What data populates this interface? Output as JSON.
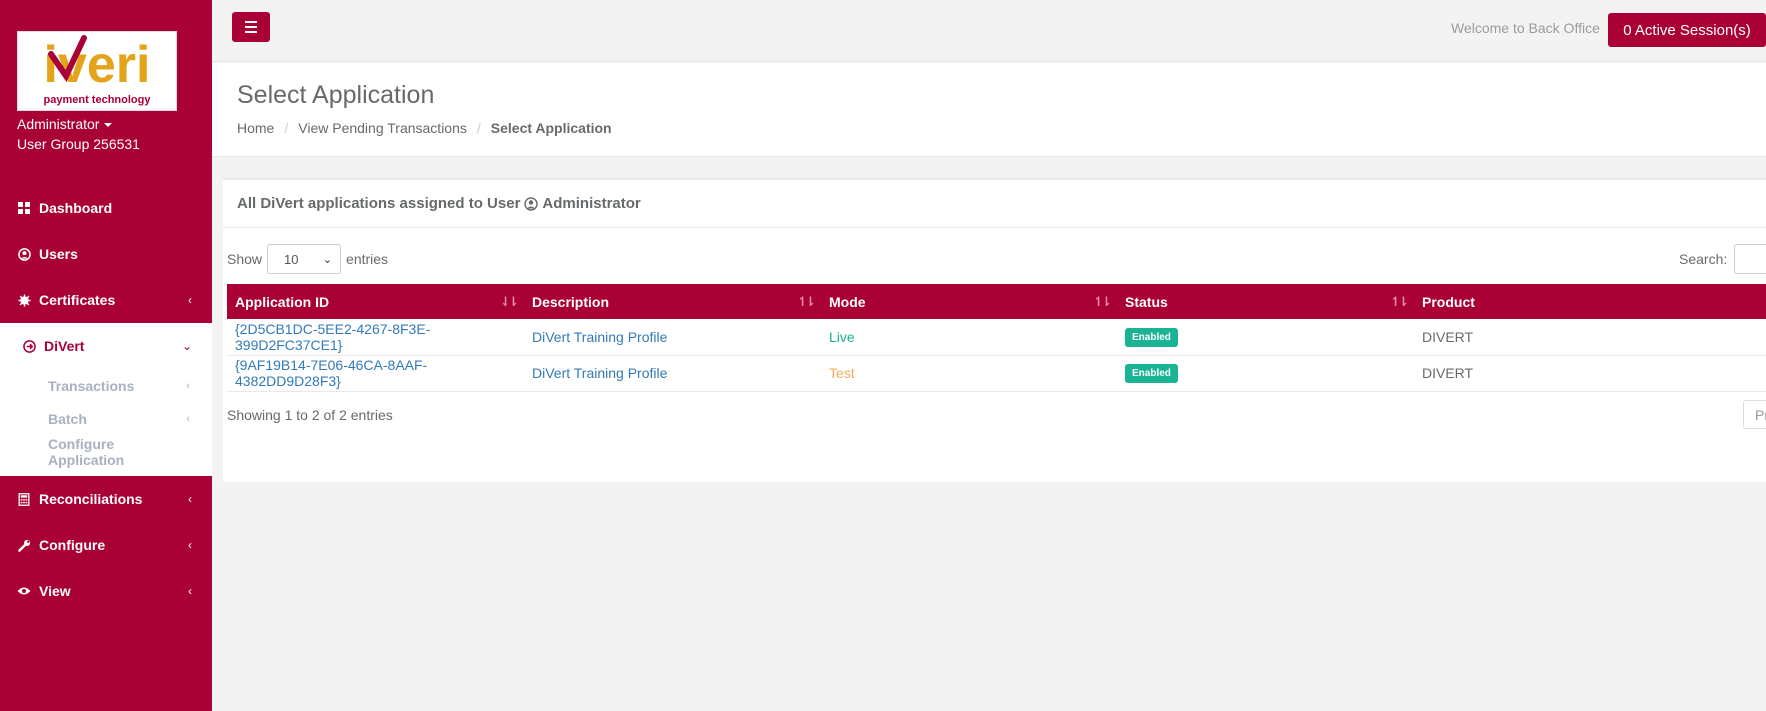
{
  "brand": {
    "logo_text": "iveri",
    "logo_tagline": "payment technology",
    "color_primary": "#a90036"
  },
  "user": {
    "name": "Administrator",
    "group": "User Group 256531"
  },
  "nav": {
    "dashboard": "Dashboard",
    "users": "Users",
    "certificates": "Certificates",
    "divert": "DiVert",
    "divert_sub": {
      "transactions": "Transactions",
      "batch": "Batch",
      "configure_application": "Configure Application"
    },
    "reconciliations": "Reconciliations",
    "configure": "Configure",
    "view": "View"
  },
  "topbar": {
    "welcome": "Welcome to Back Office",
    "sessions": "0 Active Session(s)"
  },
  "page": {
    "title": "Select Application",
    "breadcrumb": [
      "Home",
      "View Pending Transactions",
      "Select Application"
    ]
  },
  "panel": {
    "title_prefix": "All DiVert applications assigned to User",
    "title_user": "Administrator",
    "show_label": "Show",
    "entries_label": "entries",
    "page_size": "10",
    "search_label": "Search:",
    "info": "Showing 1 to 2 of 2 entries",
    "pager_prev": "Previous"
  },
  "table": {
    "headers": [
      "Application ID",
      "Description",
      "Mode",
      "Status",
      "Product"
    ],
    "rows": [
      {
        "id": "{2D5CB1DC-5EE2-4267-8F3E-399D2FC37CE1}",
        "description": "DiVert Training Profile",
        "mode": "Live",
        "status": "Enabled",
        "product": "DIVERT"
      },
      {
        "id": "{9AF19B14-7E06-46CA-8AAF-4382DD9D28F3}",
        "description": "DiVert Training Profile",
        "mode": "Test",
        "status": "Enabled",
        "product": "DIVERT"
      }
    ]
  }
}
